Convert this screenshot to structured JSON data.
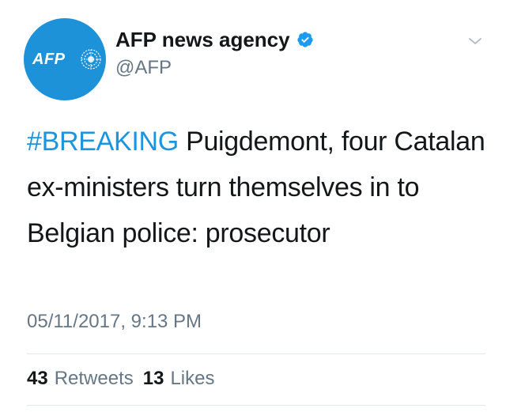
{
  "tweet": {
    "avatar": {
      "logo_text": "AFP",
      "color": "#1d92d8"
    },
    "display_name": "AFP news agency",
    "verified": true,
    "handle": "@AFP",
    "text": {
      "hashtag": "#BREAKING",
      "body": " Puigdemont, four Catalan ex-ministers turn themselves in to Belgian police: prosecutor"
    },
    "timestamp": "05/11/2017, 9:13 PM",
    "stats": {
      "retweets_count": "43",
      "retweets_label": "Retweets",
      "likes_count": "13",
      "likes_label": "Likes"
    },
    "icons": {
      "verified": "verified-badge-icon",
      "menu": "chevron-down-icon"
    },
    "colors": {
      "accent": "#1b95e0",
      "secondary_text": "#657786",
      "primary_text": "#14171a",
      "verified": "#1d9bf0"
    }
  }
}
